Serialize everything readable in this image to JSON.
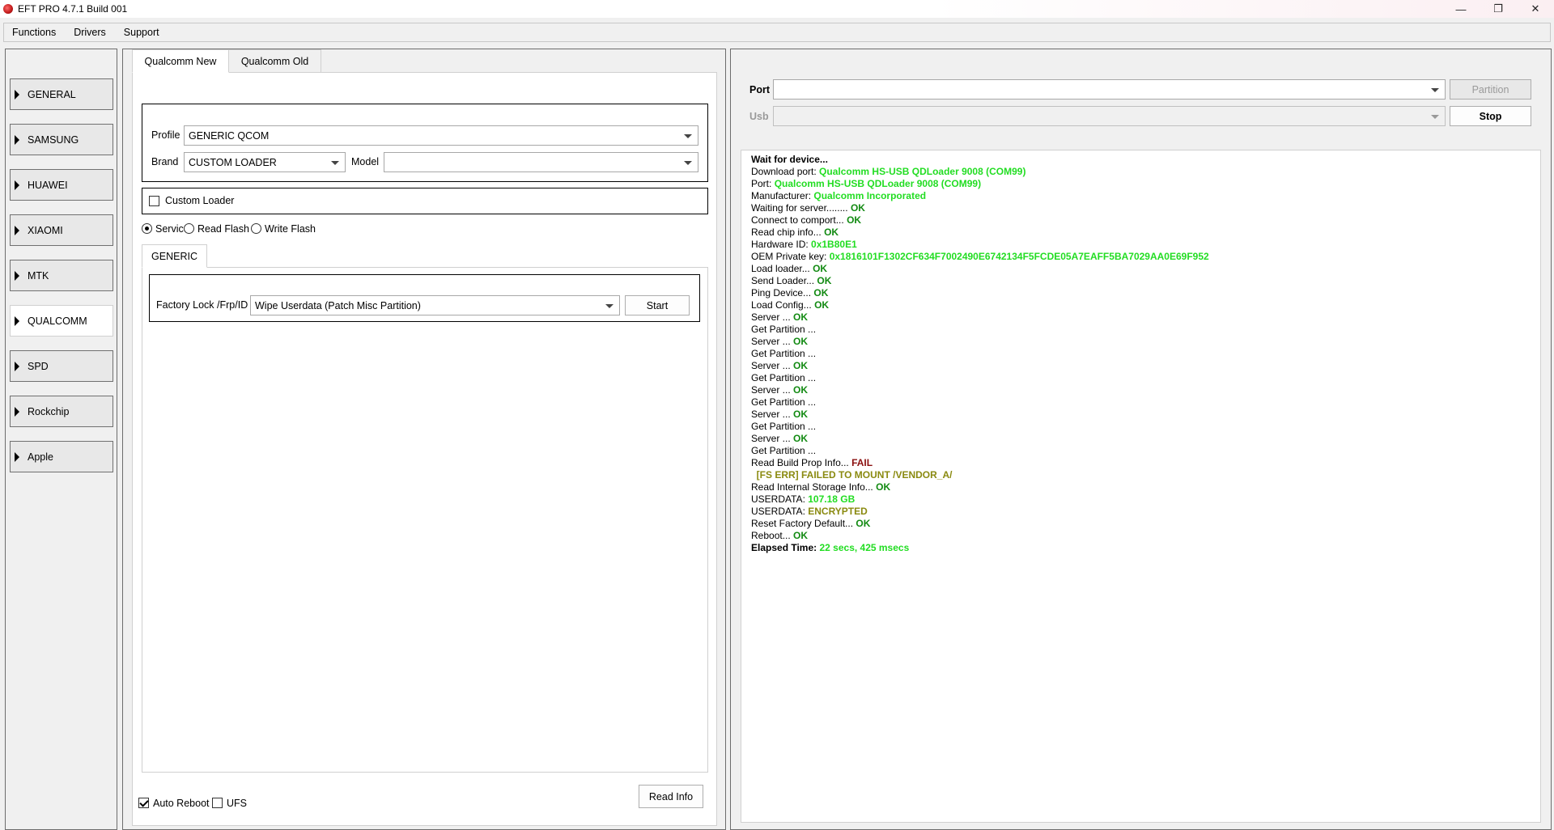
{
  "window": {
    "title": "EFT PRO 4.7.1 Build 001",
    "controls": {
      "minimize": "—",
      "maximize": "❐",
      "close": "✕"
    }
  },
  "menu": [
    "Functions",
    "Drivers",
    "Support"
  ],
  "sidebar": {
    "items": [
      {
        "label": "GENERAL"
      },
      {
        "label": "SAMSUNG"
      },
      {
        "label": "HUAWEI"
      },
      {
        "label": "XIAOMI"
      },
      {
        "label": "MTK"
      },
      {
        "label": "QUALCOMM",
        "active": true
      },
      {
        "label": "SPD"
      },
      {
        "label": "Rockchip"
      },
      {
        "label": "Apple"
      }
    ]
  },
  "main": {
    "tabs": [
      {
        "label": "Qualcomm New",
        "active": true
      },
      {
        "label": "Qualcomm Old"
      }
    ],
    "profile": {
      "label": "Profile",
      "value": "GENERIC QCOM"
    },
    "brand": {
      "label": "Brand",
      "value": "CUSTOM LOADER"
    },
    "model": {
      "label": "Model",
      "value": ""
    },
    "custom_loader": {
      "label": "Custom Loader",
      "checked": false
    },
    "modes": [
      {
        "label": "Service",
        "checked": true
      },
      {
        "label": "Read Flash",
        "checked": false
      },
      {
        "label": "Write Flash",
        "checked": false
      }
    ],
    "subtab": {
      "label": "GENERIC"
    },
    "factory": {
      "label": "Factory Lock /Frp/ID",
      "value": "Wipe Userdata (Patch Misc Partition)",
      "start_label": "Start"
    },
    "auto_reboot": {
      "label": "Auto Reboot",
      "checked": true
    },
    "ufs": {
      "label": "UFS",
      "checked": false
    },
    "read_info_label": "Read Info"
  },
  "right": {
    "port_label": "Port",
    "port_value": "",
    "usb_label": "Usb",
    "usb_value": "",
    "partition_label": "Partition",
    "stop_label": "Stop",
    "colors": {
      "green": "#22dd22",
      "darkgreen": "#128a12",
      "red": "#8b1010",
      "olive": "#8a8a10"
    },
    "log": [
      {
        "text": "Wait for device...",
        "bold": true
      },
      {
        "text": "Download port: ",
        "value": "Qualcomm HS-USB QDLoader 9008 (COM99)",
        "color": "green"
      },
      {
        "text": "Port: ",
        "value": "Qualcomm HS-USB QDLoader 9008 (COM99)",
        "color": "green"
      },
      {
        "text": "Manufacturer: ",
        "value": "Qualcomm Incorporated",
        "color": "green"
      },
      {
        "text": "Waiting for server........ ",
        "value": "OK",
        "color": "darkgreen"
      },
      {
        "text": "Connect to comport... ",
        "value": "OK",
        "color": "darkgreen"
      },
      {
        "text": "Read chip info... ",
        "value": "OK",
        "color": "darkgreen"
      },
      {
        "text": "Hardware ID: ",
        "value": "0x1B80E1",
        "color": "green"
      },
      {
        "text": "OEM Private key: ",
        "value": "0x1816101F1302CF634F7002490E6742134F5FCDE05A7EAFF5BA7029AA0E69F952",
        "color": "green"
      },
      {
        "text": "Load loader... ",
        "value": "OK",
        "color": "darkgreen"
      },
      {
        "text": "Send Loader... ",
        "value": "OK",
        "color": "darkgreen"
      },
      {
        "text": "Ping Device... ",
        "value": "OK",
        "color": "darkgreen"
      },
      {
        "text": "Load Config... ",
        "value": "OK",
        "color": "darkgreen"
      },
      {
        "text": "Server ... ",
        "value": "OK",
        "color": "darkgreen"
      },
      {
        "text": "Get Partition ..."
      },
      {
        "text": "Server ... ",
        "value": "OK",
        "color": "darkgreen"
      },
      {
        "text": "Get Partition ..."
      },
      {
        "text": "Server ... ",
        "value": "OK",
        "color": "darkgreen"
      },
      {
        "text": "Get Partition ..."
      },
      {
        "text": "Server ... ",
        "value": "OK",
        "color": "darkgreen"
      },
      {
        "text": "Get Partition ..."
      },
      {
        "text": "Server ... ",
        "value": "OK",
        "color": "darkgreen"
      },
      {
        "text": "Get Partition ..."
      },
      {
        "text": "Server ... ",
        "value": "OK",
        "color": "darkgreen"
      },
      {
        "text": "Get Partition ..."
      },
      {
        "text": "Read Build Prop Info... ",
        "value": "FAIL",
        "color": "red"
      },
      {
        "text": "",
        "value": "  [FS ERR] FAILED TO MOUNT /VENDOR_A/",
        "color": "olive"
      },
      {
        "text": "Read Internal Storage Info... ",
        "value": "OK",
        "color": "darkgreen"
      },
      {
        "text": "USERDATA: ",
        "value": "107.18 GB",
        "color": "green"
      },
      {
        "text": "USERDATA: ",
        "value": "ENCRYPTED",
        "color": "olive"
      },
      {
        "text": "Reset Factory Default... ",
        "value": "OK",
        "color": "darkgreen"
      },
      {
        "text": "Reboot... ",
        "value": "OK",
        "color": "darkgreen"
      },
      {
        "text": "Elapsed Time: ",
        "value": "22 secs, 425 msecs",
        "color": "green",
        "bold": true
      }
    ]
  }
}
